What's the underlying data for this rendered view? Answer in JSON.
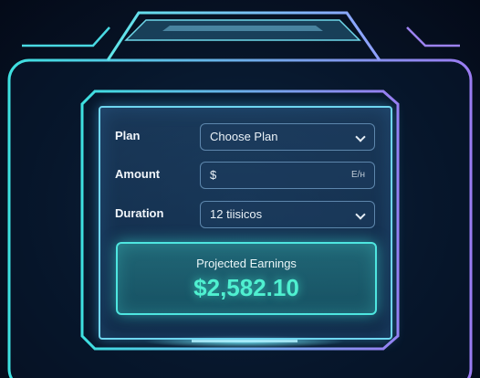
{
  "form": {
    "plan": {
      "label": "Plan",
      "value": "Choose Plan",
      "icon": "chevron-down-icon"
    },
    "amount": {
      "label": "Amount",
      "value": "$",
      "suffix": "E/н"
    },
    "duration": {
      "label": "Duration",
      "value": "12 tiisicos",
      "icon": "chevron-down-icon"
    }
  },
  "earnings": {
    "title": "Projected Earnings",
    "value": "$2,582.10"
  },
  "colors": {
    "accent_cyan": "#4ee6e0",
    "accent_purple": "#8a7cf0",
    "earnings_text": "#4ff0d0"
  }
}
